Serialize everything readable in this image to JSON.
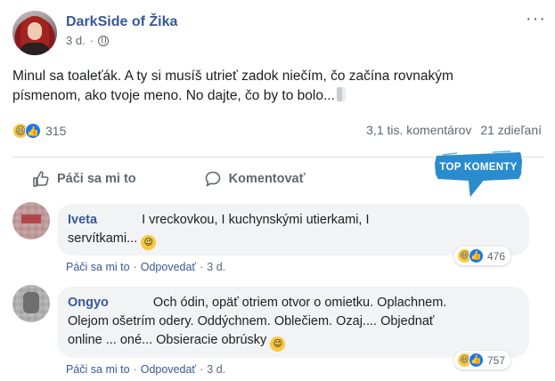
{
  "post": {
    "page_name": "DarkSide of Žika",
    "time": "3 d.",
    "text_line1": "Minul sa toaleťák. A ty si musíš utrieť zadok niečím, čo začína rovnakým",
    "text_line2": "písmenom, ako tvoje meno. No dajte, čo by to bolo...",
    "reaction_count": "315",
    "comments_count": "3,1 tis. komentárov",
    "shares_count": "21 zdieľaní"
  },
  "actions": {
    "like_label": "Páči sa mi to",
    "comment_label": "Komentovať"
  },
  "badge": {
    "text": "TOP KOMENTY",
    "color": "#2a8ccc"
  },
  "comments": [
    {
      "name": "Iveta",
      "text_line1": "I vreckovkou, I kuchynskými utierkami, I",
      "text_line2": "servítkami...",
      "like_label": "Páči sa mi to",
      "reply_label": "Odpovedať",
      "time": "3 d.",
      "reaction_count": "476"
    },
    {
      "name": "Ongyo",
      "text_line1": "Och ódin, opäť otriem otvor o omietku. Oplachnem.",
      "text_line2": "Olejom ošetrím odery. Oddýchnem. Oblečiem. Ozaj.... Objednať",
      "text_line3": "online ... oné... Obsieracie obrúsky",
      "like_label": "Páči sa mi to",
      "reply_label": "Odpovedať",
      "time": "3 d.",
      "reaction_count": "757"
    }
  ],
  "colors": {
    "link_blue": "#385898",
    "like_blue": "#1877f2",
    "haha_yellow": "#f7c841",
    "bubble_bg": "#f2f3f5",
    "meta_gray": "#606770"
  },
  "icons": [
    "globe-icon",
    "more-options-icon",
    "haha-icon",
    "like-icon",
    "thumbs-up-icon",
    "comment-icon",
    "toilet-paper-icon",
    "wink-emoji-icon"
  ]
}
